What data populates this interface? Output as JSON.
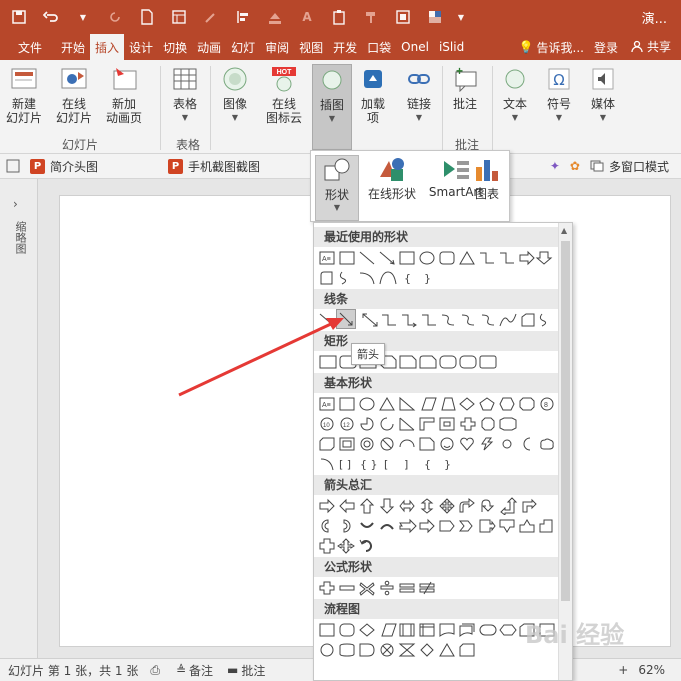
{
  "titlebar": {
    "title": "演..."
  },
  "tabs": {
    "items": [
      "文件",
      "开始",
      "插入",
      "设计",
      "切换",
      "动画",
      "幻灯",
      "审阅",
      "视图",
      "开发",
      "口袋",
      "Onel",
      "iSlid"
    ],
    "tell_me": "告诉我...",
    "login": "登录",
    "share": "共享"
  },
  "ribbon": {
    "new_slide": "新建\n幻灯片",
    "online_slide": "在线\n幻灯片",
    "new_anim_page": "新加\n动画页",
    "table": "表格",
    "image": "图像",
    "online_icons": "在线\n图标云",
    "illustrations": "插图",
    "addins": "加载\n项",
    "links": "链接",
    "comment": "批注",
    "text": "文本",
    "symbols": "符号",
    "media": "媒体",
    "group_slides": "幻灯片",
    "group_tables": "表格",
    "group_comments": "批注"
  },
  "toolbar2": {
    "intro_header": "简介头图",
    "phone_screenshot": "手机截图截图",
    "multi_window": "多窗口模式"
  },
  "thumbs": {
    "label": "缩略图"
  },
  "flyout1": {
    "shapes": "形状",
    "online_shapes": "在线形状",
    "smartart": "SmartArt",
    "chart": "图表"
  },
  "flyout2": {
    "sections": [
      "最近使用的形状",
      "线条",
      "矩形",
      "基本形状",
      "箭头总汇",
      "公式形状",
      "流程图"
    ],
    "tooltip": "箭头"
  },
  "status": {
    "slide_info": "幻灯片 第 1 张，共 1 张",
    "notes": "备注",
    "comments": "批注",
    "zoom": "62%"
  },
  "colors": {
    "accent": "#b7472a",
    "ribbon_bg": "#f3f3f3",
    "arrow": "#e53935"
  },
  "watermark": "Bai 经验"
}
